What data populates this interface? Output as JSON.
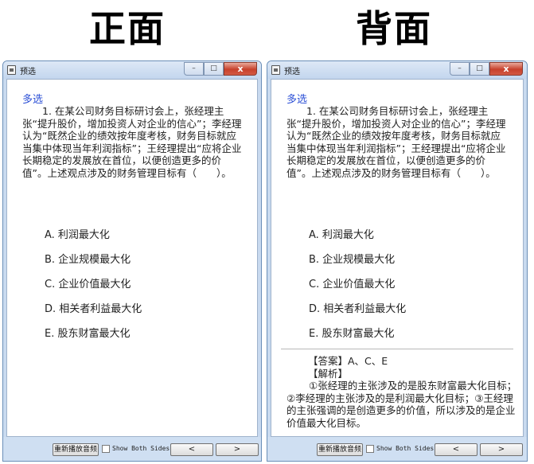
{
  "headings": {
    "front": "正面",
    "back": "背面"
  },
  "window": {
    "title": "预选",
    "controls": {
      "minimize": "–",
      "maximize": "□",
      "close": "x"
    }
  },
  "question": {
    "type": "多选",
    "text": "　　1. 在某公司财务目标研讨会上，张经理主张“提升股价，增加投资人对企业的信心”；李经理认为“既然企业的绩效按年度考核，财务目标就应当集中体现当年利润指标”；王经理提出“应将企业长期稳定的发展放在首位，以便创造更多的价值”。上述观点涉及的财务管理目标有（　　）。",
    "options": [
      "A.  利润最大化",
      "B.  企业规模最大化",
      "C.  企业价值最大化",
      "D.  相关者利益最大化",
      "E.  股东财富最大化"
    ]
  },
  "answer": {
    "answer_line": "【答案】A、C、E",
    "analysis_label": "【解析】",
    "analysis_text": "①张经理的主张涉及的是股东财富最大化目标；②李经理的主张涉及的是利润最大化目标；③王经理的主张强调的是创造更多的价值，所以涉及的是企业价值最大化目标。"
  },
  "footer": {
    "replay_label": "重新播放音频",
    "show_both_label": "Show Both Sides",
    "show_both_checked": false,
    "prev_label": "<",
    "next_label": ">"
  },
  "colors": {
    "accent": "#2b4fd6",
    "frame": "#c9daef",
    "close": "#c7412c"
  }
}
